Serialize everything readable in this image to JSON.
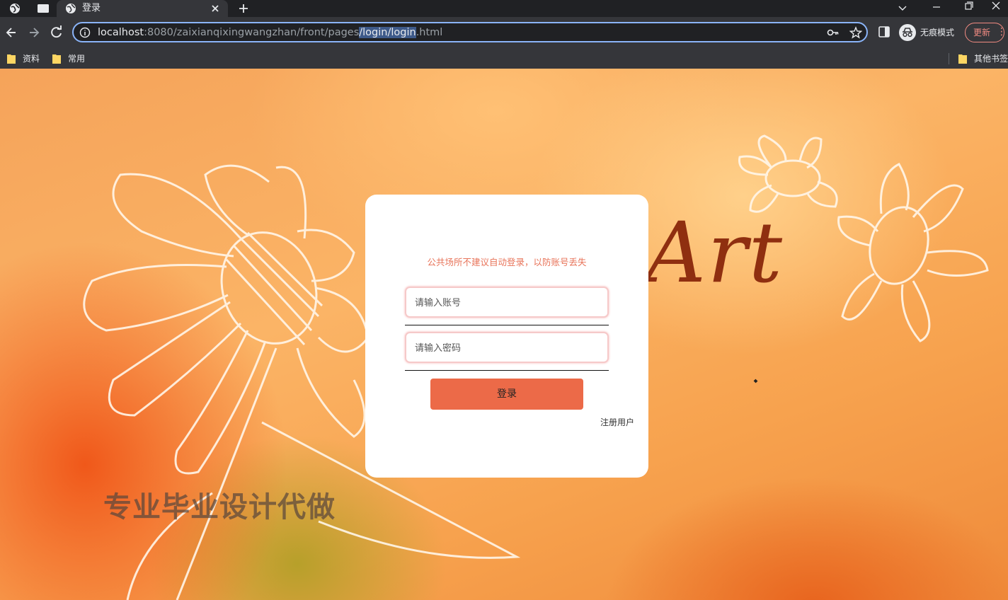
{
  "browser": {
    "tab": {
      "title": "登录"
    },
    "address": {
      "host": "localhost",
      "rest_before": ":8080/zaixianqixingwangzhan/front/pages",
      "selected": "/login/login",
      "rest_after": ".html"
    },
    "profile_label": "无痕模式",
    "update_label": "更新",
    "bookmarks": [
      "资料",
      "常用"
    ],
    "other_bookmarks": "其他书签"
  },
  "page": {
    "art_text": "Art",
    "promo_text": "专业毕业设计代做",
    "login": {
      "tip": "公共场所不建议自动登录，以防账号丢失",
      "account_placeholder": "请输入账号",
      "password_placeholder": "请输入密码",
      "login_button": "登录",
      "register_link": "注册用户"
    }
  }
}
